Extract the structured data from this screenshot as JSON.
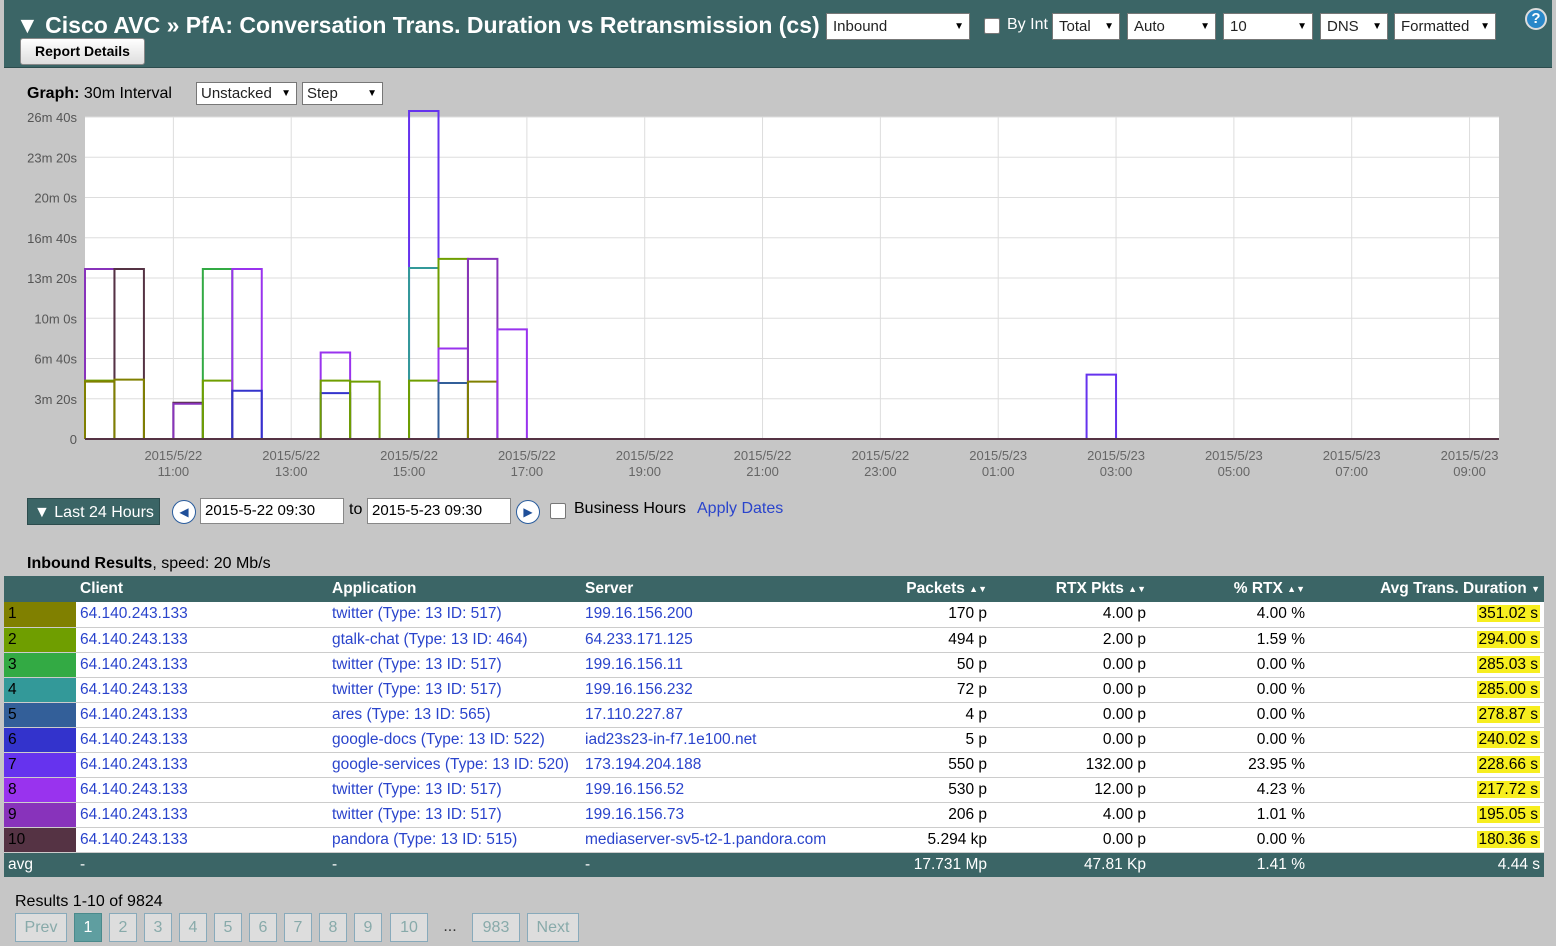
{
  "header": {
    "title": "▼ Cisco AVC » PfA: Conversation Trans. Duration vs Retransmission (cs)",
    "report_details": "Report Details",
    "direction": "Inbound",
    "by_int_label": "By Int",
    "aggregation": "Total",
    "scale": "Auto",
    "top_n": "10",
    "resolve": "DNS",
    "format": "Formatted",
    "help": "?"
  },
  "graph_controls": {
    "label": "Graph:",
    "interval": "30m Interval",
    "stack_mode": "Unstacked",
    "line_style": "Step"
  },
  "chart_data": {
    "type": "bar",
    "ylim": [
      0,
      1600
    ],
    "y_ticks": [
      {
        "value": 0,
        "label": "0"
      },
      {
        "value": 200,
        "label": "3m 20s"
      },
      {
        "value": 400,
        "label": "6m 40s"
      },
      {
        "value": 600,
        "label": "10m 0s"
      },
      {
        "value": 800,
        "label": "13m 20s"
      },
      {
        "value": 1000,
        "label": "16m 40s"
      },
      {
        "value": 1200,
        "label": "20m 0s"
      },
      {
        "value": 1400,
        "label": "23m 20s"
      },
      {
        "value": 1600,
        "label": "26m 40s"
      }
    ],
    "x_ticks": [
      {
        "date": "2015/5/22",
        "time": "11:00"
      },
      {
        "date": "2015/5/22",
        "time": "13:00"
      },
      {
        "date": "2015/5/22",
        "time": "15:00"
      },
      {
        "date": "2015/5/22",
        "time": "17:00"
      },
      {
        "date": "2015/5/22",
        "time": "19:00"
      },
      {
        "date": "2015/5/22",
        "time": "21:00"
      },
      {
        "date": "2015/5/22",
        "time": "23:00"
      },
      {
        "date": "2015/5/23",
        "time": "01:00"
      },
      {
        "date": "2015/5/23",
        "time": "03:00"
      },
      {
        "date": "2015/5/23",
        "time": "05:00"
      },
      {
        "date": "2015/5/23",
        "time": "07:00"
      },
      {
        "date": "2015/5/23",
        "time": "09:00"
      }
    ],
    "x_range": [
      "2015-05-22 09:30",
      "2015-05-23 09:30"
    ],
    "bars": [
      {
        "start": "2015-05-22 09:30",
        "end": "2015-05-22 10:00",
        "values": [
          {
            "series": 9,
            "value": 845
          },
          {
            "series": 2,
            "value": 290
          },
          {
            "series": 1,
            "value": 285
          }
        ]
      },
      {
        "start": "2015-05-22 10:00",
        "end": "2015-05-22 10:30",
        "values": [
          {
            "series": 10,
            "value": 845
          },
          {
            "series": 1,
            "value": 295
          }
        ]
      },
      {
        "start": "2015-05-22 11:00",
        "end": "2015-05-22 11:30",
        "values": [
          {
            "series": 10,
            "value": 180
          },
          {
            "series": 9,
            "value": 175
          }
        ]
      },
      {
        "start": "2015-05-22 11:30",
        "end": "2015-05-22 12:00",
        "values": [
          {
            "series": 3,
            "value": 845
          },
          {
            "series": 2,
            "value": 290
          }
        ]
      },
      {
        "start": "2015-05-22 12:00",
        "end": "2015-05-22 12:30",
        "values": [
          {
            "series": 8,
            "value": 845
          },
          {
            "series": 6,
            "value": 240
          }
        ]
      },
      {
        "start": "2015-05-22 13:30",
        "end": "2015-05-22 14:00",
        "values": [
          {
            "series": 8,
            "value": 430
          },
          {
            "series": 6,
            "value": 228
          },
          {
            "series": 2,
            "value": 290
          }
        ]
      },
      {
        "start": "2015-05-22 14:00",
        "end": "2015-05-22 14:30",
        "values": [
          {
            "series": 2,
            "value": 285
          }
        ]
      },
      {
        "start": "2015-05-22 15:00",
        "end": "2015-05-22 15:30",
        "values": [
          {
            "series": 7,
            "value": 1630
          },
          {
            "series": 4,
            "value": 850
          },
          {
            "series": 2,
            "value": 290
          }
        ]
      },
      {
        "start": "2015-05-22 15:30",
        "end": "2015-05-22 16:00",
        "values": [
          {
            "series": 2,
            "value": 895
          },
          {
            "series": 8,
            "value": 450
          },
          {
            "series": 5,
            "value": 278
          }
        ]
      },
      {
        "start": "2015-05-22 16:00",
        "end": "2015-05-22 16:30",
        "values": [
          {
            "series": 9,
            "value": 895
          },
          {
            "series": 1,
            "value": 285
          }
        ]
      },
      {
        "start": "2015-05-22 16:30",
        "end": "2015-05-22 17:00",
        "values": [
          {
            "series": 8,
            "value": 545
          }
        ]
      },
      {
        "start": "2015-05-23 02:30",
        "end": "2015-05-23 03:00",
        "values": [
          {
            "series": 7,
            "value": 320
          }
        ]
      }
    ]
  },
  "date_range": {
    "preset": "▼ Last 24 Hours",
    "prev_icon": "◀",
    "next_icon": "▶",
    "start": "2015-5-22 09:30",
    "to_label": "to",
    "end": "2015-5-23 09:30",
    "business_hours_label": "Business Hours",
    "apply_label": "Apply Dates"
  },
  "results": {
    "title": "Inbound Results",
    "speed": ", speed: 20 Mb/s",
    "columns": {
      "client": "Client",
      "application": "Application",
      "server": "Server",
      "packets": "Packets",
      "rtx_pkts": "RTX Pkts",
      "pct_rtx": "% RTX",
      "avg_duration": "Avg Trans. Duration"
    },
    "rows": [
      {
        "n": "1",
        "color": "#808000",
        "client": "64.140.243.133",
        "application": "twitter (Type: 13 ID: 517)",
        "server": "199.16.156.200",
        "packets": "170 p",
        "rtx": "4.00 p",
        "pct": "4.00 %",
        "dur": "351.02 s"
      },
      {
        "n": "2",
        "color": "#6f9e00",
        "client": "64.140.243.133",
        "application": "gtalk-chat (Type: 13 ID: 464)",
        "server": "64.233.171.125",
        "packets": "494 p",
        "rtx": "2.00 p",
        "pct": "1.59 %",
        "dur": "294.00 s"
      },
      {
        "n": "3",
        "color": "#33aa44",
        "client": "64.140.243.133",
        "application": "twitter (Type: 13 ID: 517)",
        "server": "199.16.156.11",
        "packets": "50 p",
        "rtx": "0.00 p",
        "pct": "0.00 %",
        "dur": "285.03 s"
      },
      {
        "n": "4",
        "color": "#339999",
        "client": "64.140.243.133",
        "application": "twitter (Type: 13 ID: 517)",
        "server": "199.16.156.232",
        "packets": "72 p",
        "rtx": "0.00 p",
        "pct": "0.00 %",
        "dur": "285.00 s"
      },
      {
        "n": "5",
        "color": "#335f99",
        "client": "64.140.243.133",
        "application": "ares (Type: 13 ID: 565)",
        "server": "17.110.227.87",
        "packets": "4 p",
        "rtx": "0.00 p",
        "pct": "0.00 %",
        "dur": "278.87 s"
      },
      {
        "n": "6",
        "color": "#3333cc",
        "client": "64.140.243.133",
        "application": "google-docs (Type: 13 ID: 522)",
        "server": "iad23s23-in-f7.1e100.net",
        "packets": "5 p",
        "rtx": "0.00 p",
        "pct": "0.00 %",
        "dur": "240.02 s"
      },
      {
        "n": "7",
        "color": "#6633ee",
        "client": "64.140.243.133",
        "application": "google-services (Type: 13 ID: 520)",
        "server": "173.194.204.188",
        "packets": "550 p",
        "rtx": "132.00 p",
        "pct": "23.95 %",
        "dur": "228.66 s"
      },
      {
        "n": "8",
        "color": "#9933ee",
        "client": "64.140.243.133",
        "application": "twitter (Type: 13 ID: 517)",
        "server": "199.16.156.52",
        "packets": "530 p",
        "rtx": "12.00 p",
        "pct": "4.23 %",
        "dur": "217.72 s"
      },
      {
        "n": "9",
        "color": "#8833bb",
        "client": "64.140.243.133",
        "application": "twitter (Type: 13 ID: 517)",
        "server": "199.16.156.73",
        "packets": "206 p",
        "rtx": "4.00 p",
        "pct": "1.01 %",
        "dur": "195.05 s"
      },
      {
        "n": "10",
        "color": "#553344",
        "client": "64.140.243.133",
        "application": "pandora (Type: 13 ID: 515)",
        "server": "mediaserver-sv5-t2-1.pandora.com",
        "packets": "5.294 kp",
        "rtx": "0.00 p",
        "pct": "0.00 %",
        "dur": "180.36 s"
      }
    ],
    "avg": {
      "label": "avg",
      "client": "-",
      "application": "-",
      "server": "-",
      "packets": "17.731 Mp",
      "rtx": "47.81 Kp",
      "pct": "1.41 %",
      "dur": "4.44 s"
    },
    "count": "Results 1-10 of 9824"
  },
  "pagination": {
    "prev": "Prev",
    "pages": [
      "1",
      "2",
      "3",
      "4",
      "5",
      "6",
      "7",
      "8",
      "9",
      "10"
    ],
    "ellipsis": "...",
    "last": "983",
    "next": "Next"
  }
}
